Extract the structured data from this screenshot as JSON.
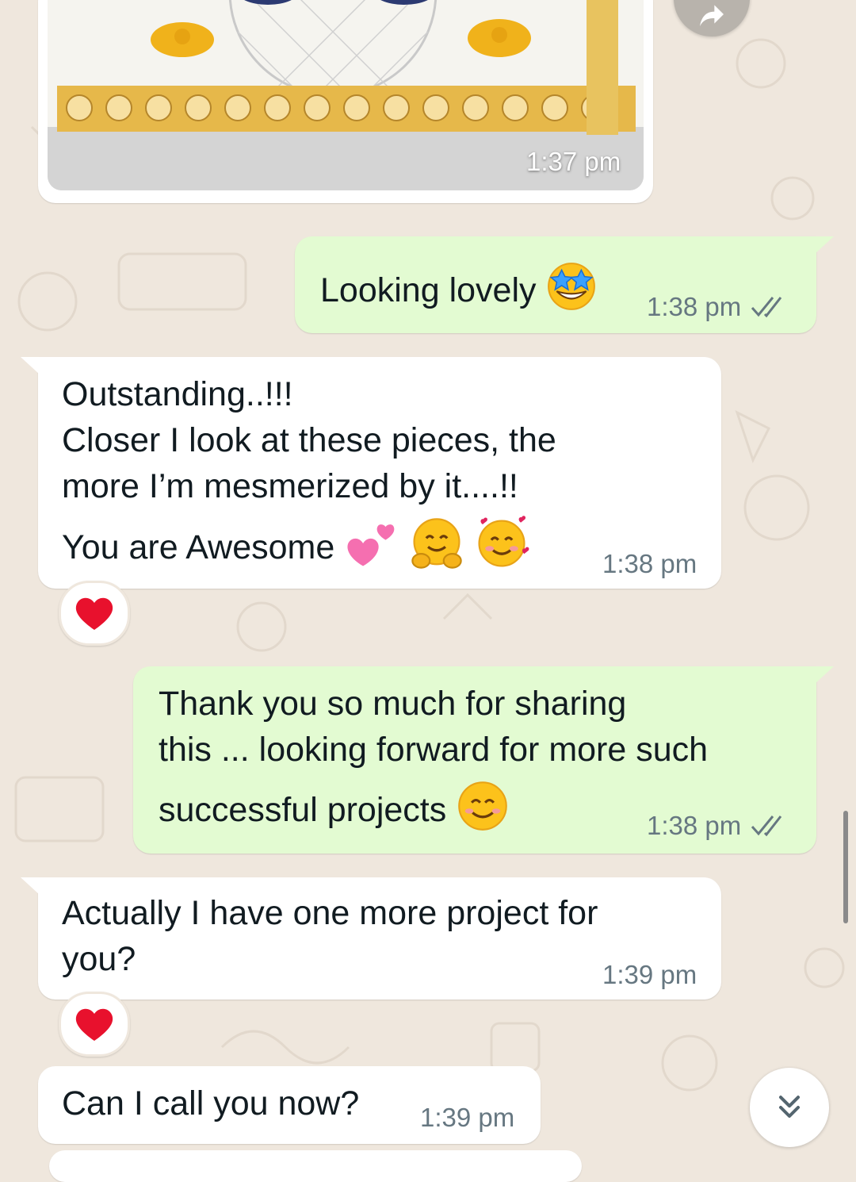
{
  "messages": [
    {
      "id": "m0",
      "type": "image",
      "direction": "incoming",
      "time": "1:37 pm"
    },
    {
      "id": "m1",
      "direction": "outgoing",
      "text": "Looking lovely",
      "emoji": "star-struck",
      "time": "1:38 pm",
      "status": "read"
    },
    {
      "id": "m2",
      "direction": "incoming",
      "lines": [
        "Outstanding..!!!",
        "Closer I look at these pieces, the",
        "more I’m mesmerized by it....!!",
        "You are Awesome"
      ],
      "emojis": [
        "two-hearts",
        "hugging-face",
        "smiling-face-with-hearts"
      ],
      "time": "1:38 pm",
      "reaction": "red-heart"
    },
    {
      "id": "m3",
      "direction": "outgoing",
      "lines": [
        "Thank you so much for sharing",
        "this ... looking forward for more such",
        "successful projects"
      ],
      "emoji": "smiling-face",
      "time": "1:38 pm",
      "status": "read"
    },
    {
      "id": "m4",
      "direction": "incoming",
      "lines": [
        "Actually I have one more project for",
        "you?"
      ],
      "time": "1:39 pm",
      "reaction": "red-heart"
    },
    {
      "id": "m5",
      "direction": "incoming",
      "text": "Can I call you now?",
      "time": "1:39 pm"
    }
  ],
  "controls": {
    "forward_icon": "share-forward-icon",
    "scroll_down_icon": "double-chevron-down-icon"
  },
  "colors": {
    "background": "#efe7dd",
    "incoming": "#ffffff",
    "outgoing": "#e3fbd2",
    "meta": "#667781",
    "read_tick": "#667781"
  }
}
